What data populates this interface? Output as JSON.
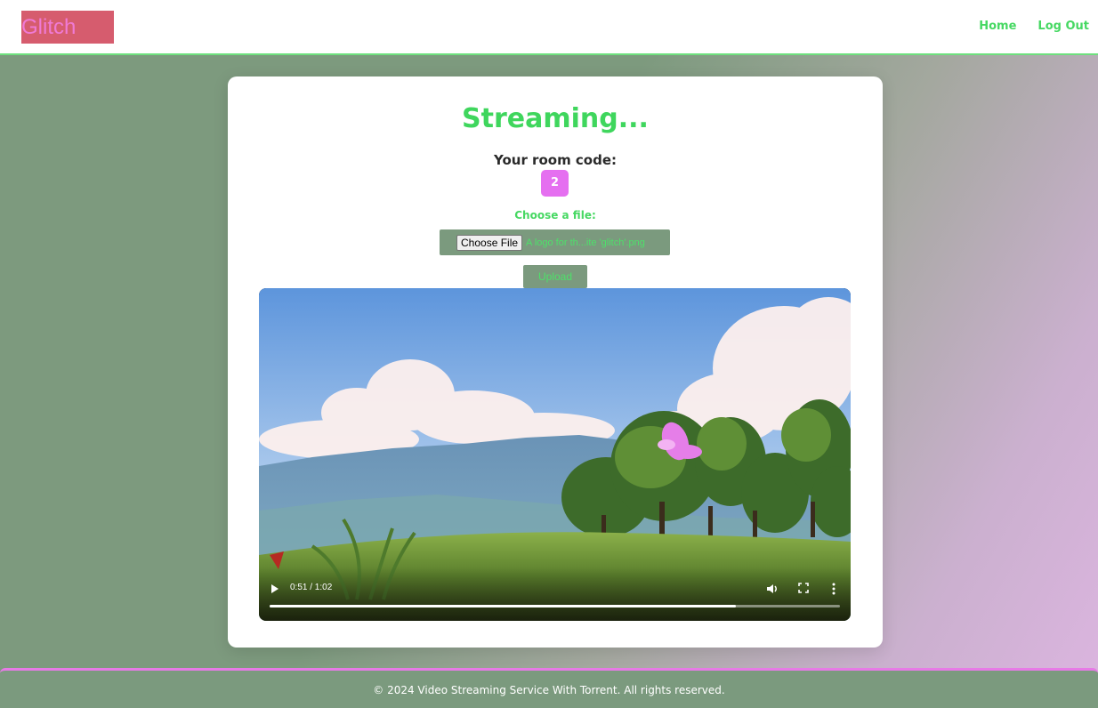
{
  "header": {
    "logo": "Glitch",
    "nav": [
      {
        "label": "Home"
      },
      {
        "label": "Log Out"
      }
    ]
  },
  "main": {
    "title": "Streaming...",
    "room_code_label": "Your room code:",
    "room_code": "2",
    "file_label": "Choose a file:",
    "choose_button": "Choose File",
    "file_name": "A logo for th...ite 'glitch'.png",
    "upload_button": "Upload"
  },
  "video": {
    "time": "0:51 / 1:02",
    "progress_fraction": 0.817,
    "icons": [
      "play-icon",
      "volume-icon",
      "fullscreen-icon",
      "more-options-icon"
    ]
  },
  "footer": {
    "text": "© 2024 Video Streaming Service With Torrent. All rights reserved."
  },
  "colors": {
    "accent_green": "#46d862",
    "logo_bg": "#d65c6e",
    "logo_text": "#f07ad6",
    "room_code_bg": "#e56ff0",
    "muted_green": "#7b9a7e",
    "footer_border": "#e77ae6"
  }
}
